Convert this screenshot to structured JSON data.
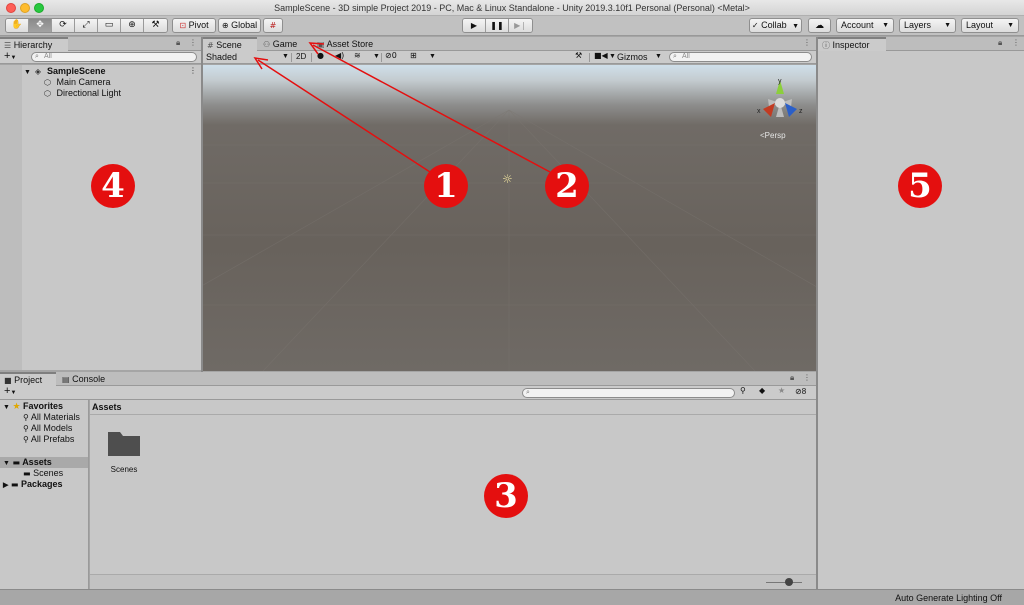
{
  "window": {
    "title": "SampleScene - 3D simple Project 2019 - PC, Mac & Linux Standalone - Unity 2019.3.10f1 Personal (Personal) <Metal>"
  },
  "toolbar": {
    "tools": [
      "hand-tool",
      "move-tool",
      "rotate-tool",
      "scale-tool",
      "rect-tool",
      "transform-tool",
      "custom-tool"
    ],
    "pivot_label": "Pivot",
    "global_label": "Global",
    "collab_label": "Collab",
    "account_label": "Account",
    "layers_label": "Layers",
    "layout_label": "Layout"
  },
  "hierarchy": {
    "tab_label": "Hierarchy",
    "add_label": "+",
    "search_placeholder": "All",
    "scene_name": "SampleScene",
    "items": [
      "Main Camera",
      "Directional Light"
    ]
  },
  "scene_panel": {
    "tabs": [
      "Scene",
      "Game",
      "Asset Store"
    ],
    "shading_mode": "Shaded",
    "mode_2d": "2D",
    "hidden_count": "0",
    "gizmos_label": "Gizmos",
    "search_placeholder": "All",
    "axes": {
      "x": "x",
      "y": "y",
      "z": "z"
    },
    "projection_label": "Persp"
  },
  "inspector": {
    "tab_label": "Inspector"
  },
  "project": {
    "tabs": [
      "Project",
      "Console"
    ],
    "add_label": "+",
    "favorites_label": "Favorites",
    "favorites": [
      "All Materials",
      "All Models",
      "All Prefabs"
    ],
    "assets_label": "Assets",
    "asset_children": [
      "Scenes"
    ],
    "packages_label": "Packages",
    "breadcrumb": "Assets",
    "folders": [
      "Scenes"
    ],
    "hidden_count": "8"
  },
  "status_bar": {
    "text": "Auto Generate Lighting Off"
  },
  "annotations": {
    "markers": [
      "1",
      "2",
      "3",
      "4",
      "5"
    ],
    "color": "#e40f0f"
  }
}
